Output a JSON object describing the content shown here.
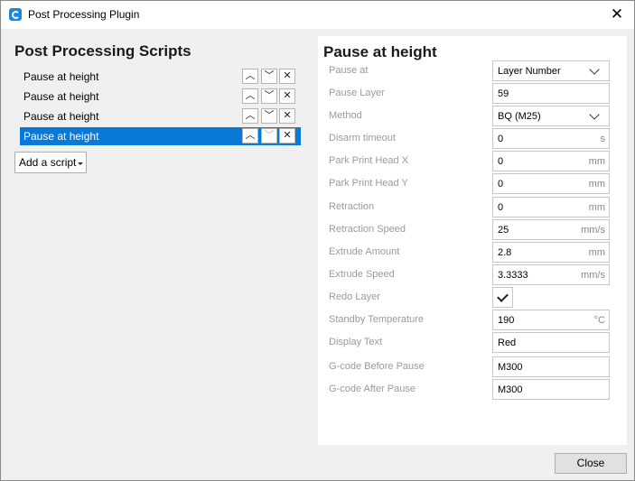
{
  "window": {
    "title": "Post Processing Plugin",
    "close_glyph": "✕"
  },
  "left": {
    "heading": "Post Processing Scripts",
    "scripts": [
      {
        "label": "Pause at height",
        "selected": false
      },
      {
        "label": "Pause at height",
        "selected": false
      },
      {
        "label": "Pause at height",
        "selected": false
      },
      {
        "label": "Pause at height",
        "selected": true
      }
    ],
    "add_script_label": "Add a script"
  },
  "panel": {
    "heading": "Pause at height",
    "settings": [
      {
        "label": "Pause at",
        "value": "Layer Number",
        "unit": "",
        "kind": "dropdown"
      },
      {
        "label": "Pause Layer",
        "value": "59",
        "unit": "",
        "kind": "text"
      },
      {
        "label": "Method",
        "value": "BQ (M25)",
        "unit": "",
        "kind": "dropdown"
      },
      {
        "label": "Disarm timeout",
        "value": "0",
        "unit": "s",
        "kind": "text"
      },
      {
        "label": "Park Print Head X",
        "value": "0",
        "unit": "mm",
        "kind": "text"
      },
      {
        "label": "Park Print Head Y",
        "value": "0",
        "unit": "mm",
        "kind": "text"
      },
      {
        "label": "Retraction",
        "value": "0",
        "unit": "mm",
        "kind": "text"
      },
      {
        "label": "Retraction Speed",
        "value": "25",
        "unit": "mm/s",
        "kind": "text"
      },
      {
        "label": "Extrude Amount",
        "value": "2.8",
        "unit": "mm",
        "kind": "text"
      },
      {
        "label": "Extrude Speed",
        "value": "3.3333",
        "unit": "mm/s",
        "kind": "text"
      },
      {
        "label": "Redo Layer",
        "value": "",
        "unit": "",
        "kind": "checkbox",
        "checked": true
      },
      {
        "label": "Standby Temperature",
        "value": "190",
        "unit": "°C",
        "kind": "text"
      },
      {
        "label": "Display Text",
        "value": "Red",
        "unit": "",
        "kind": "text"
      },
      {
        "label": "G-code Before Pause",
        "value": "M300",
        "unit": "",
        "kind": "text"
      },
      {
        "label": "G-code After Pause",
        "value": "M300",
        "unit": "",
        "kind": "text"
      }
    ]
  },
  "footer": {
    "close_label": "Close"
  }
}
